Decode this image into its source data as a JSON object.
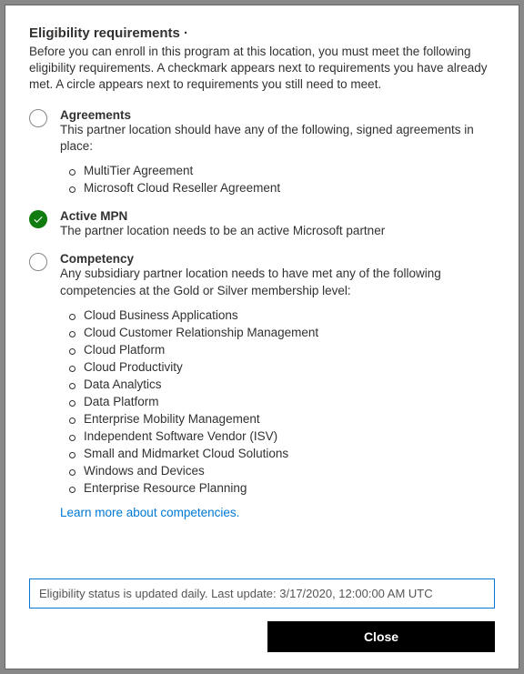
{
  "title": "Eligibility requirements ·",
  "intro": "Before you can enroll in this program at this location, you must meet the following eligibility requirements. A checkmark appears next to requirements you have already met. A circle appears next to requirements you still need to meet.",
  "requirements": {
    "agreements": {
      "title": "Agreements",
      "desc": "This partner location should have any of the following, signed agreements in place:",
      "items": [
        "MultiTier Agreement",
        "Microsoft Cloud Reseller Agreement"
      ]
    },
    "activeMpn": {
      "title": "Active MPN",
      "desc": "The partner location needs to be an active Microsoft partner"
    },
    "competency": {
      "title": "Competency",
      "desc": "Any subsidiary partner location needs to have met any of the following competencies at the Gold or Silver membership level:",
      "items": [
        "Cloud Business Applications",
        "Cloud Customer Relationship Management",
        "Cloud Platform",
        "Cloud Productivity",
        "Data Analytics",
        "Data Platform",
        "Enterprise Mobility Management",
        "Independent Software Vendor (ISV)",
        "Small and Midmarket Cloud Solutions",
        "Windows and Devices",
        "Enterprise Resource Planning"
      ],
      "learn_link": "Learn more about competencies."
    }
  },
  "status_bar": "Eligibility status is updated daily. Last update: 3/17/2020, 12:00:00 AM UTC",
  "close_label": "Close"
}
